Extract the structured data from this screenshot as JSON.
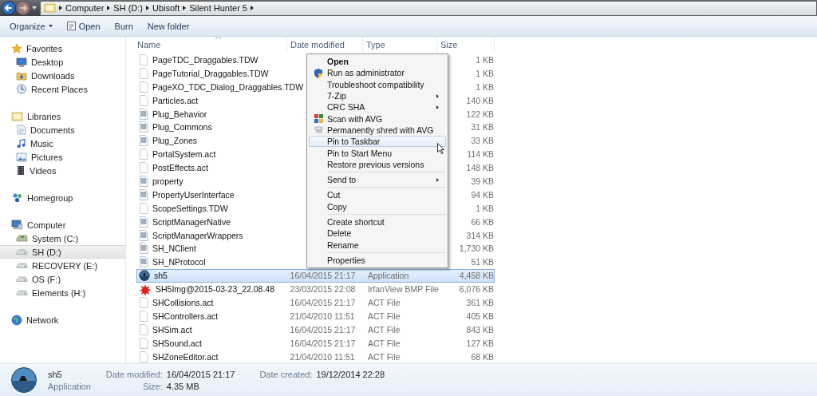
{
  "nav": {
    "path": [
      "Computer",
      "SH  (D:)",
      "Ubisoft",
      "Silent Hunter 5"
    ]
  },
  "toolbar": [
    {
      "label": "Organize",
      "kind": "dropdown"
    },
    {
      "label": "Open",
      "kind": "icon"
    },
    {
      "label": "Burn",
      "kind": "plain"
    },
    {
      "label": "New folder",
      "kind": "plain"
    }
  ],
  "sidebar": [
    {
      "label": "Favorites",
      "kind": "star",
      "items": [
        {
          "label": "Desktop",
          "kind": "desktop",
          "selected": false
        },
        {
          "label": "Downloads",
          "kind": "downloads",
          "selected": false
        },
        {
          "label": "Recent Places",
          "kind": "recent",
          "selected": false
        }
      ]
    },
    {
      "label": "Libraries",
      "kind": "library",
      "items": [
        {
          "label": "Documents",
          "kind": "documents",
          "selected": false
        },
        {
          "label": "Music",
          "kind": "music",
          "selected": false
        },
        {
          "label": "Pictures",
          "kind": "pictures",
          "selected": false
        },
        {
          "label": "Videos",
          "kind": "videos",
          "selected": false
        }
      ]
    },
    {
      "label": "Homegroup",
      "kind": "homegroup"
    },
    {
      "label": "Computer",
      "kind": "computer",
      "items": [
        {
          "label": "System (C:)",
          "kind": "system",
          "selected": false
        },
        {
          "label": "SH  (D:)",
          "kind": "drive",
          "selected": true
        },
        {
          "label": "RECOVERY (E:)",
          "kind": "drive",
          "selected": false
        },
        {
          "label": "OS (F:)",
          "kind": "drive",
          "selected": false
        },
        {
          "label": "Elements (H:)",
          "kind": "drive",
          "selected": false
        }
      ]
    },
    {
      "label": "Network",
      "kind": "network"
    }
  ],
  "columns": [
    "Name",
    "Date modified",
    "Type",
    "Size"
  ],
  "files": [
    {
      "name": "PageTDC_Draggables.TDW",
      "kind": "blank",
      "size": "1 KB",
      "selected": false
    },
    {
      "name": "PageTutorial_Draggables.TDW",
      "kind": "blank",
      "size": "1 KB",
      "selected": false
    },
    {
      "name": "PageXO_TDC_Dialog_Draggables.TDW",
      "kind": "blank",
      "size": "1 KB",
      "selected": false
    },
    {
      "name": "Particles.act",
      "kind": "blank",
      "size": "140 KB",
      "selected": false
    },
    {
      "name": "Plug_Behavior",
      "kind": "config",
      "size": "122 KB",
      "selected": false
    },
    {
      "name": "Plug_Commons",
      "kind": "config",
      "size": "31 KB",
      "selected": false
    },
    {
      "name": "Plug_Zones",
      "kind": "config",
      "size": "33 KB",
      "selected": false
    },
    {
      "name": "PortalSystem.act",
      "kind": "blank",
      "size": "114 KB",
      "selected": false
    },
    {
      "name": "PostEffects.act",
      "kind": "blank",
      "size": "148 KB",
      "selected": false
    },
    {
      "name": "property",
      "kind": "config",
      "size": "39 KB",
      "selected": false
    },
    {
      "name": "PropertyUserInterface",
      "kind": "config",
      "size": "94 KB",
      "selected": false
    },
    {
      "name": "ScopeSettings.TDW",
      "kind": "blank",
      "size": "1 KB",
      "selected": false
    },
    {
      "name": "ScriptManagerNative",
      "kind": "config",
      "size": "66 KB",
      "selected": false
    },
    {
      "name": "ScriptManagerWrappers",
      "kind": "config",
      "size": "314 KB",
      "selected": false
    },
    {
      "name": "SH_NClient",
      "kind": "config",
      "size": "1,730 KB",
      "selected": false
    },
    {
      "name": "SH_NProtocol",
      "kind": "config",
      "size": "51 KB",
      "selected": false
    },
    {
      "name": "sh5",
      "kind": "app",
      "date": "16/04/2015 21:17",
      "type": "Application",
      "size": "4,458 KB",
      "selected": true
    },
    {
      "name": "SH5Img@2015-03-23_22.08.48",
      "kind": "image",
      "date": "23/03/2015 22:08",
      "type": "IrfanView BMP File",
      "size": "6,076 KB",
      "selected": false
    },
    {
      "name": "SHCollisions.act",
      "kind": "blank",
      "date": "16/04/2015 21:17",
      "type": "ACT File",
      "size": "361 KB",
      "selected": false
    },
    {
      "name": "SHControllers.act",
      "kind": "blank",
      "date": "21/04/2010 11:51",
      "type": "ACT File",
      "size": "405 KB",
      "selected": false
    },
    {
      "name": "SHSim.act",
      "kind": "blank",
      "date": "16/04/2015 21:17",
      "type": "ACT File",
      "size": "843 KB",
      "selected": false
    },
    {
      "name": "SHSound.act",
      "kind": "blank",
      "date": "16/04/2015 21:17",
      "type": "ACT File",
      "size": "127 KB",
      "selected": false
    },
    {
      "name": "SHZoneEditor.act",
      "kind": "blank",
      "date": "21/04/2010 11:51",
      "type": "ACT File",
      "size": "68 KB",
      "selected": false
    }
  ],
  "context_menu": [
    {
      "kind": "item",
      "label": "Open",
      "bold": true,
      "submenu": false,
      "highlighted": false
    },
    {
      "kind": "item",
      "label": "Run as administrator",
      "bold": false,
      "submenu": false,
      "highlighted": false
    },
    {
      "kind": "item",
      "label": "Troubleshoot compatibility",
      "bold": false,
      "submenu": false,
      "highlighted": false
    },
    {
      "kind": "item",
      "label": "7-Zip",
      "bold": false,
      "submenu": true,
      "highlighted": false
    },
    {
      "kind": "item",
      "label": "CRC SHA",
      "bold": false,
      "submenu": true,
      "highlighted": false
    },
    {
      "kind": "item",
      "label": "Scan with AVG",
      "bold": false,
      "submenu": false,
      "highlighted": false
    },
    {
      "kind": "item",
      "label": "Permanently shred with AVG",
      "bold": false,
      "submenu": false,
      "highlighted": false
    },
    {
      "kind": "item",
      "label": "Pin to Taskbar",
      "bold": false,
      "submenu": false,
      "highlighted": true
    },
    {
      "kind": "item",
      "label": "Pin to Start Menu",
      "bold": false,
      "submenu": false,
      "highlighted": false
    },
    {
      "kind": "item",
      "label": "Restore previous versions",
      "bold": false,
      "submenu": false,
      "highlighted": false
    },
    {
      "kind": "separator"
    },
    {
      "kind": "item",
      "label": "Send to",
      "bold": false,
      "submenu": true,
      "highlighted": false
    },
    {
      "kind": "separator"
    },
    {
      "kind": "item",
      "label": "Cut",
      "bold": false,
      "submenu": false,
      "highlighted": false
    },
    {
      "kind": "item",
      "label": "Copy",
      "bold": false,
      "submenu": false,
      "highlighted": false
    },
    {
      "kind": "separator"
    },
    {
      "kind": "item",
      "label": "Create shortcut",
      "bold": false,
      "submenu": false,
      "highlighted": false
    },
    {
      "kind": "item",
      "label": "Delete",
      "bold": false,
      "submenu": false,
      "highlighted": false
    },
    {
      "kind": "item",
      "label": "Rename",
      "bold": false,
      "submenu": false,
      "highlighted": false
    },
    {
      "kind": "separator"
    },
    {
      "kind": "item",
      "label": "Properties",
      "bold": false,
      "submenu": false,
      "highlighted": false
    }
  ],
  "details": {
    "name": "sh5",
    "type": "Application",
    "modified_label": "Date modified:",
    "modified": "16/04/2015 21:17",
    "created_label": "Date created:",
    "created": "19/12/2014 22:28",
    "size_label": "Size:",
    "size": "4.35 MB"
  }
}
